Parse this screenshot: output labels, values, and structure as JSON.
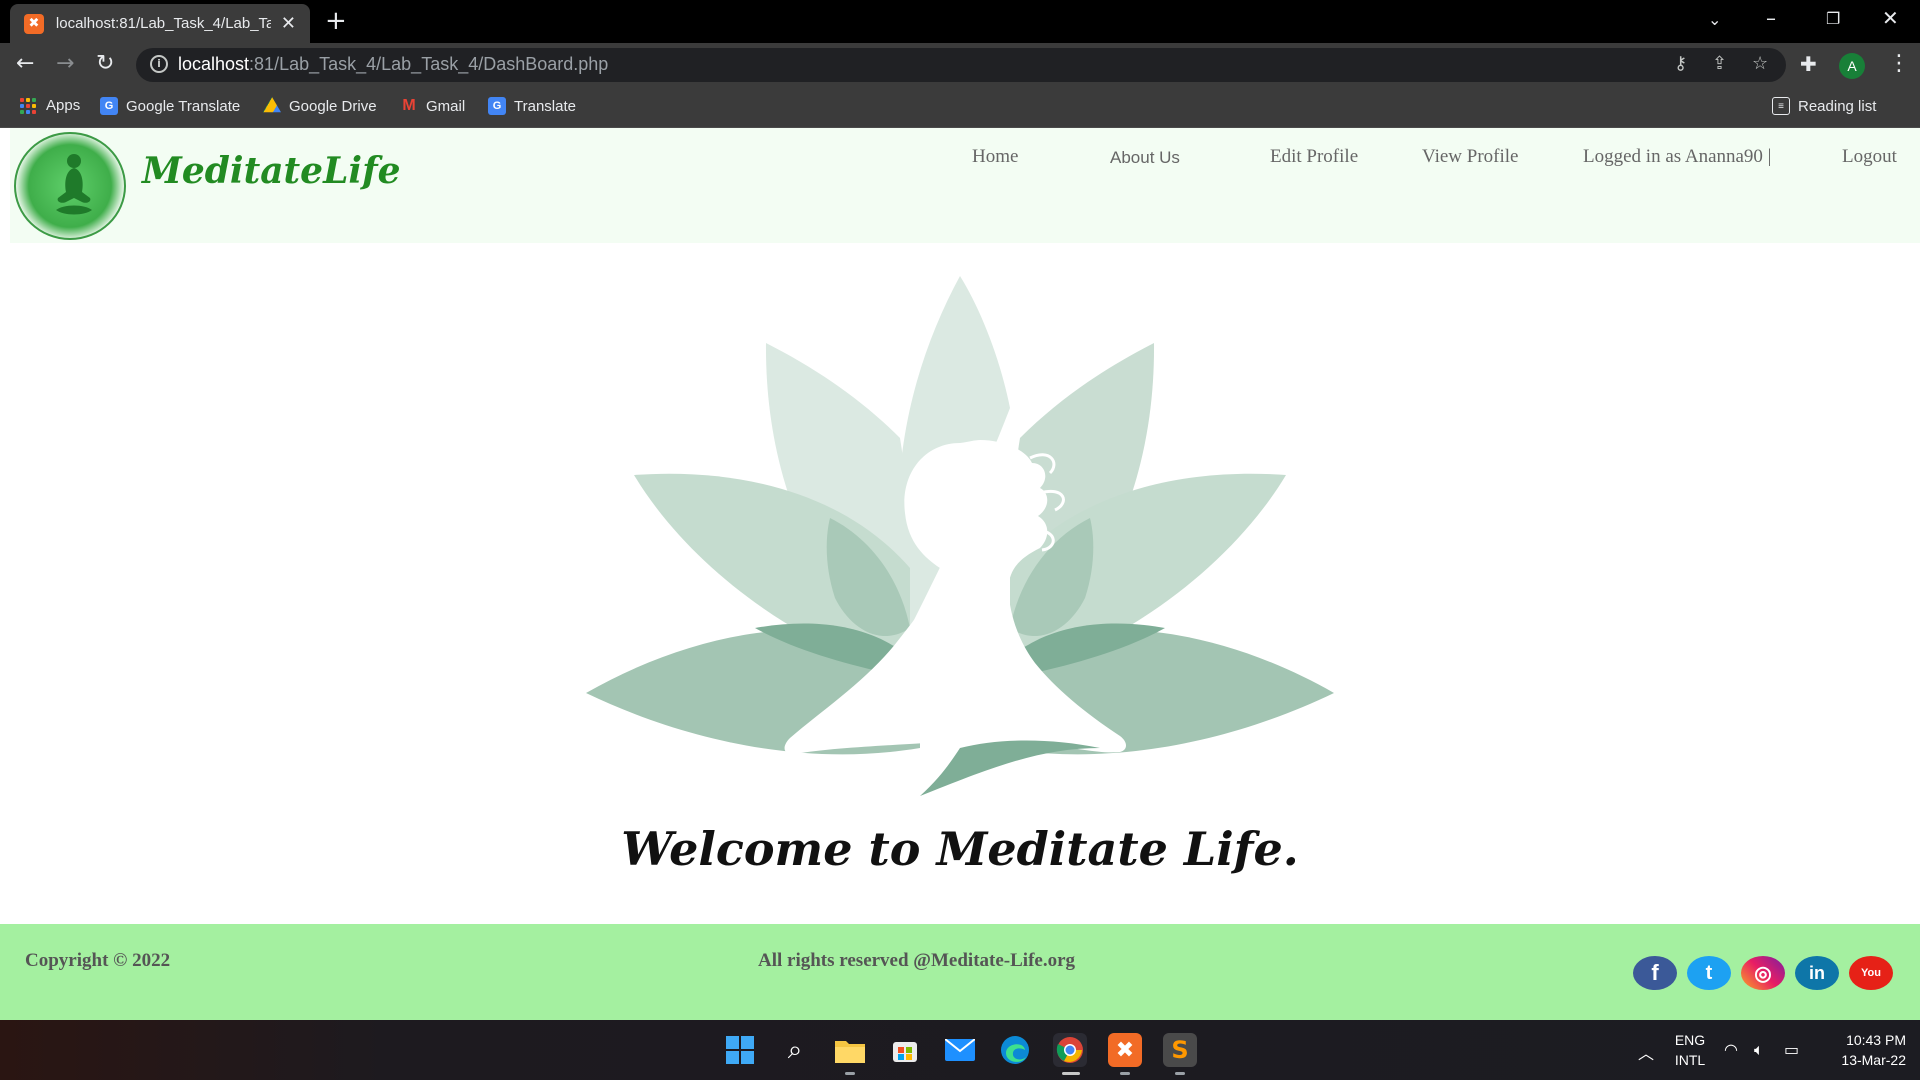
{
  "browser": {
    "tab_title": "localhost:81/Lab_Task_4/Lab_Task_4/DashBoard.php",
    "new_tab": "+",
    "close_tab": "✕",
    "url_host": "localhost",
    "url_path": ":81/Lab_Task_4/Lab_Task_4/DashBoard.php",
    "profile_initial": "A",
    "bookmarks": {
      "apps": "Apps",
      "google_translate": "Google Translate",
      "google_drive": "Google Drive",
      "gmail": "Gmail",
      "translate": "Translate",
      "reading_list": "Reading list"
    }
  },
  "site": {
    "brand": "MeditateLife",
    "nav": {
      "home": "Home",
      "about": "About Us",
      "edit_profile": "Edit Profile",
      "view_profile": "View Profile",
      "logged_in": "Logged in as Ananna90 |",
      "logout": "Logout"
    },
    "welcome": "Welcome to Meditate Life.",
    "footer": {
      "copyright": "Copyright © 2022",
      "rights": "All rights reserved @Meditate-Life.org"
    },
    "social": {
      "facebook": "f",
      "twitter": "t",
      "instagram": "◎",
      "linkedin": "in",
      "youtube": "You"
    },
    "colors": {
      "header_bg": "#f3fdf3",
      "brand": "#228b22",
      "footer_bg": "#a4f0a0",
      "lotus": "#8fbfa8"
    }
  },
  "taskbar": {
    "lang_1": "ENG",
    "lang_2": "INTL",
    "time": "10:43 PM",
    "date": "13-Mar-22"
  }
}
